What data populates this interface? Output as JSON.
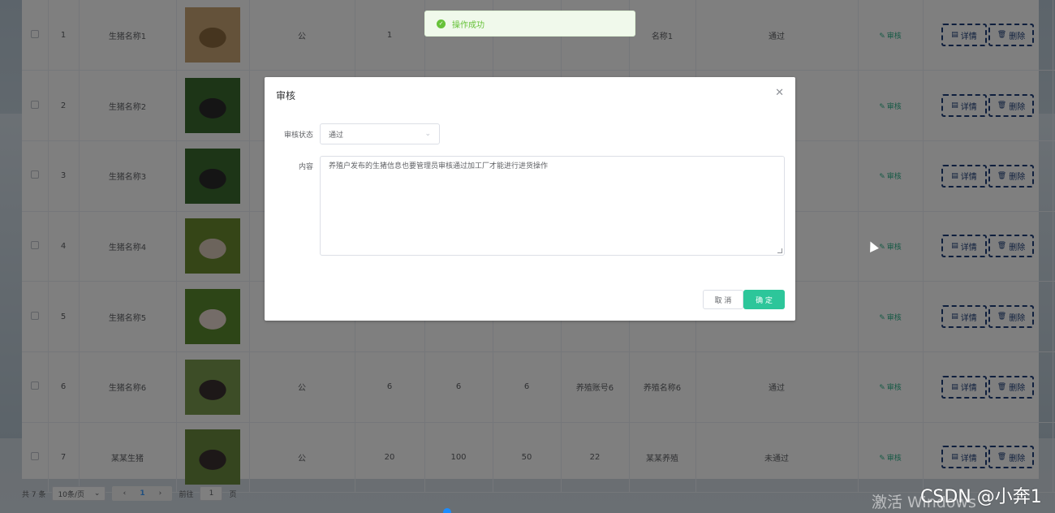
{
  "table": {
    "rows": [
      {
        "index": "1",
        "name": "生猪名称1",
        "gender": "公",
        "c1": "1",
        "c2": "",
        "c3": "",
        "c4": "",
        "c5": "名称1",
        "status": "通过",
        "img": "pig-1"
      },
      {
        "index": "2",
        "name": "生猪名称2",
        "gender": "",
        "c1": "",
        "c2": "",
        "c3": "",
        "c4": "",
        "c5": "",
        "status": "",
        "img": "pig-2"
      },
      {
        "index": "3",
        "name": "生猪名称3",
        "gender": "",
        "c1": "",
        "c2": "",
        "c3": "",
        "c4": "",
        "c5": "",
        "status": "",
        "img": "pig-3"
      },
      {
        "index": "4",
        "name": "生猪名称4",
        "gender": "",
        "c1": "",
        "c2": "",
        "c3": "",
        "c4": "",
        "c5": "",
        "status": "",
        "img": "pig-4"
      },
      {
        "index": "5",
        "name": "生猪名称5",
        "gender": "",
        "c1": "",
        "c2": "",
        "c3": "",
        "c4": "",
        "c5": "",
        "status": "",
        "img": "pig-5"
      },
      {
        "index": "6",
        "name": "生猪名称6",
        "gender": "公",
        "c1": "6",
        "c2": "6",
        "c3": "6",
        "c4": "养殖账号6",
        "c5": "养殖名称6",
        "status": "通过",
        "img": "pig-6"
      },
      {
        "index": "7",
        "name": "某某生猪",
        "gender": "公",
        "c1": "20",
        "c2": "100",
        "c3": "50",
        "c4": "22",
        "c5": "某某养殖",
        "status": "未通过",
        "img": "pig-7"
      }
    ],
    "audit_label": "审核",
    "detail_label": "详情",
    "delete_label": "删除"
  },
  "pagination": {
    "total": "共 7 条",
    "page_size": "10条/页",
    "current_page": "1",
    "goto_prefix": "前往",
    "goto_value": "1",
    "goto_suffix": "页"
  },
  "toast": {
    "message": "操作成功"
  },
  "dialog": {
    "title": "审核",
    "status_label": "审核状态",
    "status_value": "通过",
    "content_label": "内容",
    "content_value": "养殖户发布的生猪信息也要管理员审核通过加工厂才能进行进货操作",
    "cancel_label": "取 消",
    "confirm_label": "确 定"
  },
  "watermarks": {
    "activate": "激活 Windows",
    "csdn": "CSDN @小奔1"
  },
  "colors": {
    "accent": "#2dc69a",
    "audit_link": "#2fb38b",
    "op_border": "#1e3f7a",
    "toast_text": "#67c23a"
  }
}
